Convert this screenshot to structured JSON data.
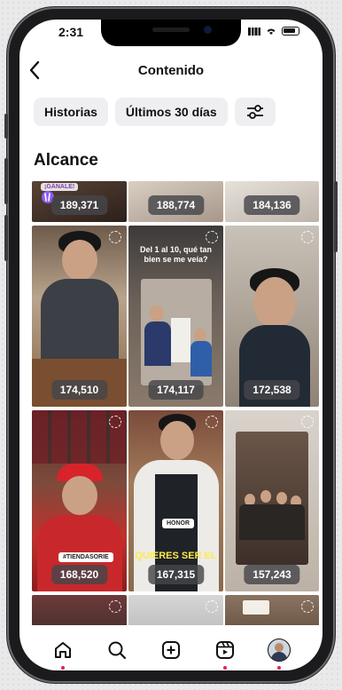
{
  "status": {
    "time": "2:31"
  },
  "header": {
    "title": "Contenido",
    "back_icon": "chevron-left-icon"
  },
  "filters": [
    {
      "label": "Historias"
    },
    {
      "label": "Últimos 30 días"
    },
    {
      "icon": "sliders-icon"
    }
  ],
  "section": {
    "title": "Alcance"
  },
  "grid": {
    "items": [
      {
        "views": "189,371",
        "sticker": "¡GÁNALE!"
      },
      {
        "views": "188,774"
      },
      {
        "views": "184,136"
      },
      {
        "views": "174,510"
      },
      {
        "views": "174,117",
        "caption": "Del 1 al 10, qué tan bien se me veía?"
      },
      {
        "views": "172,538"
      },
      {
        "views": "168,520",
        "tag": "#TIENDASORIE"
      },
      {
        "views": "167,315",
        "tag": "HONOR",
        "overlay": "QUIERES SER EL"
      },
      {
        "views": "157,243"
      },
      {
        "caption": ""
      },
      {},
      {}
    ]
  },
  "tabbar": {
    "items": [
      {
        "name": "home-icon"
      },
      {
        "name": "search-icon"
      },
      {
        "name": "create-icon"
      },
      {
        "name": "reels-icon"
      },
      {
        "name": "profile-avatar"
      }
    ]
  },
  "colors": {
    "notification_dot": "#e0245e",
    "chip_bg": "#efeff1"
  }
}
